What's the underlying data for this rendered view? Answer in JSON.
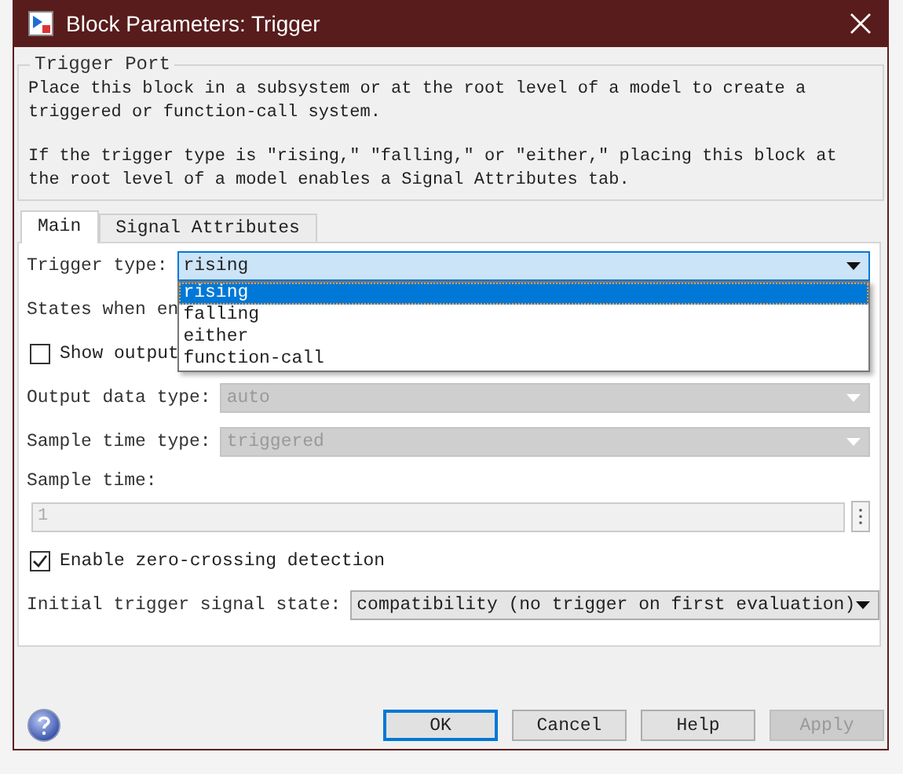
{
  "window": {
    "title": "Block Parameters: Trigger"
  },
  "group": {
    "title": "Trigger Port",
    "paragraphs": [
      "Place this block in a subsystem or at the root level of a model to create a triggered or function-call system.",
      "If the trigger type is \"rising,\" \"falling,\" or \"either,\" placing this block at the root level of a model enables a Signal Attributes tab."
    ]
  },
  "tabs": [
    {
      "label": "Main",
      "selected": true
    },
    {
      "label": "Signal Attributes",
      "selected": false
    }
  ],
  "fields": [
    {
      "kind": "dropdown",
      "label": "Trigger type:",
      "value": "rising",
      "disabled": false,
      "expanded": true,
      "options": [
        {
          "label": "rising",
          "selected": true
        },
        {
          "label": "falling",
          "selected": false
        },
        {
          "label": "either",
          "selected": false
        },
        {
          "label": "function-call",
          "selected": false
        }
      ]
    },
    {
      "kind": "label",
      "label": "States when en"
    },
    {
      "kind": "checkbox",
      "label": "Show output",
      "checked": false
    },
    {
      "kind": "dropdown",
      "label": "Output data type:",
      "value": "auto",
      "disabled": true,
      "expanded": false
    },
    {
      "kind": "dropdown",
      "label": "Sample time type:",
      "value": "triggered",
      "disabled": true,
      "expanded": false
    },
    {
      "kind": "input",
      "label": "Sample time:",
      "value": "1",
      "disabled": true
    },
    {
      "kind": "checkbox",
      "label": "Enable zero-crossing detection",
      "checked": true
    },
    {
      "kind": "dropdown",
      "label": "Initial trigger signal state:",
      "value": "compatibility (no trigger on first evaluation)",
      "disabled": false,
      "expanded": false
    }
  ],
  "buttons": [
    {
      "label": "OK",
      "default": true,
      "disabled": false
    },
    {
      "label": "Cancel",
      "default": false,
      "disabled": false
    },
    {
      "label": "Help",
      "default": false,
      "disabled": false
    },
    {
      "label": "Apply",
      "default": false,
      "disabled": true
    }
  ]
}
